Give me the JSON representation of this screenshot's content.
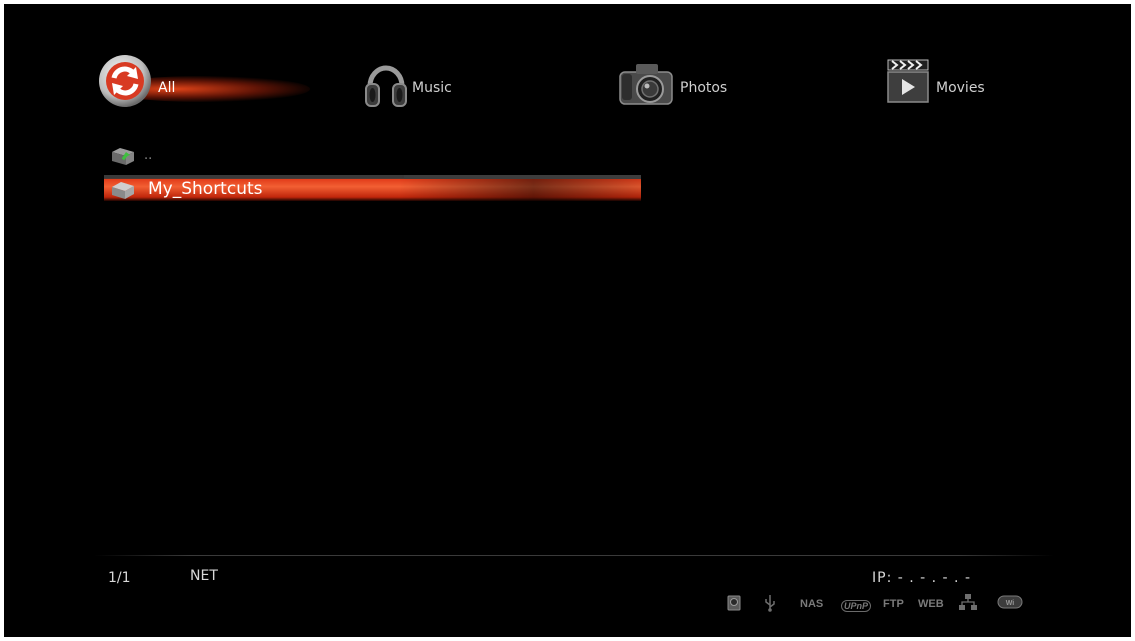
{
  "tabs": [
    {
      "label": "All",
      "icon": "refresh-icon",
      "selected": true
    },
    {
      "label": "Music",
      "icon": "headphones-icon"
    },
    {
      "label": "Photos",
      "icon": "camera-icon"
    },
    {
      "label": "Movies",
      "icon": "clapperboard-icon"
    }
  ],
  "list": {
    "parent_label": "..",
    "items": [
      {
        "label": "My_Shortcuts",
        "icon": "folder-icon",
        "selected": true
      }
    ]
  },
  "status": {
    "page": "1/1",
    "source": "NET",
    "ip": "IP: - . - . - . -",
    "indicators": [
      "hdd-icon",
      "usb-icon",
      "NAS",
      "UPnP",
      "FTP",
      "WEB",
      "network-icon",
      "wifi-icon"
    ]
  },
  "colors": {
    "accent": "#e8431c",
    "background": "#000000"
  }
}
